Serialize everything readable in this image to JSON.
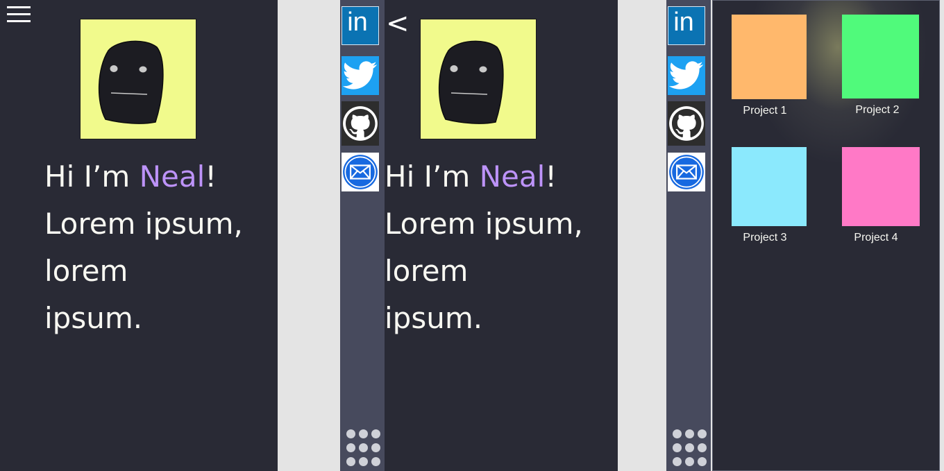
{
  "greeting": {
    "prefix": "Hi I’m ",
    "name": "Neal",
    "suffix": "!",
    "line2": "Lorem ipsum,",
    "line3": "lorem",
    "line4": "ipsum."
  },
  "nav": {
    "back_glyph": "<"
  },
  "social": {
    "linkedin_text": "in"
  },
  "projects": [
    {
      "label": "Project 1",
      "color": "#ffb86c"
    },
    {
      "label": "Project 2",
      "color": "#50fa7b"
    },
    {
      "label": "Project 3",
      "color": "#8be9fd"
    },
    {
      "label": "Project 4",
      "color": "#ff79c6"
    }
  ],
  "colors": {
    "background": "#292a35",
    "sidebar": "#474a5d",
    "accent": "#bd93f9",
    "avatar_bg": "#f1fa8c"
  },
  "icons": [
    "menu-icon",
    "back-icon",
    "linkedin-icon",
    "twitter-icon",
    "github-icon",
    "mail-icon",
    "app-grid-icon"
  ]
}
